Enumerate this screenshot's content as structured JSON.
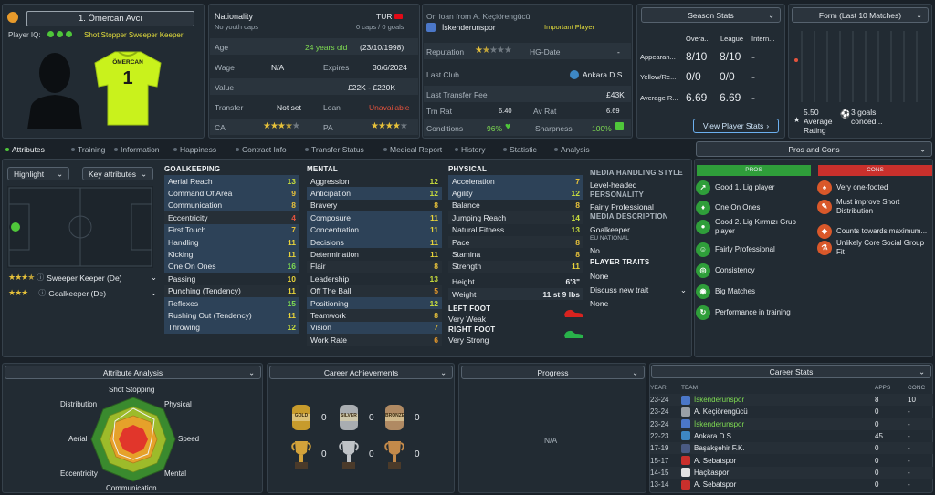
{
  "header": {
    "player_name": "1. Ömercan Avcı",
    "player_iq_label": "Player IQ:",
    "roles": "Shot Stopper  Sweeper Keeper",
    "shirt_name": "ÖMERCAN",
    "shirt_number": "1"
  },
  "info": {
    "nationality_label": "Nationality",
    "nationality_value": "TUR",
    "youth_caps": "No youth caps",
    "caps": "0 caps / 0 goals",
    "age_label": "Age",
    "age_value": "24 years old",
    "dob": "(23/10/1998)",
    "wage_label": "Wage",
    "wage_value": "N/A",
    "expires_label": "Expires",
    "expires_value": "30/6/2024",
    "value_label": "Value",
    "value_value": "£22K - £220K",
    "transfer_label": "Transfer",
    "transfer_value": "Not set",
    "loan_label": "Loan",
    "loan_value": "Unavailable",
    "ca_label": "CA",
    "pa_label": "PA"
  },
  "loan": {
    "on_loan_from": "On loan from A. Keçiörengücü",
    "club": "İskenderunspor",
    "important": "Important Player",
    "reputation_label": "Reputation",
    "hg_label": "HG-Date",
    "hg_value": "-",
    "last_club_label": "Last Club",
    "last_club_value": "Ankara D.S.",
    "last_fee_label": "Last Transfer Fee",
    "last_fee_value": "£43K",
    "trn_label": "Trn Rat",
    "trn_value": "6.40",
    "av_label": "Av Rat",
    "av_value": "6.69",
    "conditions_label": "Conditions",
    "conditions_value": "96%",
    "sharpness_label": "Sharpness",
    "sharpness_value": "100%"
  },
  "season": {
    "title": "Season Stats",
    "col1": "Overa...",
    "col2": "League",
    "col3": "Intern...",
    "rows": [
      {
        "label": "Appearan...",
        "a": "8/10",
        "b": "8/10",
        "c": "-"
      },
      {
        "label": "Yellow/Re...",
        "a": "0/0",
        "b": "0/0",
        "c": "-"
      },
      {
        "label": "Average R...",
        "a": "6.69",
        "b": "6.69",
        "c": "-"
      }
    ],
    "button": "View Player Stats"
  },
  "form": {
    "title": "Form (Last 10 Matches)",
    "avg_value": "5.50",
    "avg_label": "Average Rating",
    "goals_value": "3 goals",
    "goals_label": "conced..."
  },
  "tabs": [
    "Attributes",
    "Training",
    "Information",
    "Happiness",
    "Contract Info",
    "Transfer Status",
    "Medical Report",
    "History",
    "Statistic",
    "Analysis"
  ],
  "pitch": {
    "highlight": "Highlight",
    "key_attributes": "Key attributes",
    "role1": "Sweeper Keeper (De)",
    "role2": "Goalkeeper (De)"
  },
  "goalkeeping": {
    "title": "GOALKEEPING",
    "rows": [
      {
        "name": "Aerial Reach",
        "value": "13"
      },
      {
        "name": "Command Of Area",
        "value": "9"
      },
      {
        "name": "Communication",
        "value": "8"
      },
      {
        "name": "Eccentricity",
        "value": "4"
      },
      {
        "name": "First Touch",
        "value": "7"
      },
      {
        "name": "Handling",
        "value": "11"
      },
      {
        "name": "Kicking",
        "value": "11"
      },
      {
        "name": "One On Ones",
        "value": "16"
      },
      {
        "name": "Passing",
        "value": "10"
      },
      {
        "name": "Punching (Tendency)",
        "value": "11"
      },
      {
        "name": "Reflexes",
        "value": "15"
      },
      {
        "name": "Rushing Out (Tendency)",
        "value": "11"
      },
      {
        "name": "Throwing",
        "value": "12"
      }
    ]
  },
  "mental": {
    "title": "MENTAL",
    "rows": [
      {
        "name": "Aggression",
        "value": "12"
      },
      {
        "name": "Anticipation",
        "value": "12"
      },
      {
        "name": "Bravery",
        "value": "8"
      },
      {
        "name": "Composure",
        "value": "11"
      },
      {
        "name": "Concentration",
        "value": "11"
      },
      {
        "name": "Decisions",
        "value": "11"
      },
      {
        "name": "Determination",
        "value": "11"
      },
      {
        "name": "Flair",
        "value": "8"
      },
      {
        "name": "Leadership",
        "value": "13"
      },
      {
        "name": "Off The Ball",
        "value": "5"
      },
      {
        "name": "Positioning",
        "value": "12"
      },
      {
        "name": "Teamwork",
        "value": "8"
      },
      {
        "name": "Vision",
        "value": "7"
      },
      {
        "name": "Work Rate",
        "value": "6"
      }
    ]
  },
  "physical": {
    "title": "PHYSICAL",
    "rows": [
      {
        "name": "Acceleration",
        "value": "7"
      },
      {
        "name": "Agility",
        "value": "12"
      },
      {
        "name": "Balance",
        "value": "8"
      },
      {
        "name": "Jumping Reach",
        "value": "14"
      },
      {
        "name": "Natural Fitness",
        "value": "13"
      },
      {
        "name": "Pace",
        "value": "8"
      },
      {
        "name": "Stamina",
        "value": "8"
      },
      {
        "name": "Strength",
        "value": "11"
      }
    ],
    "height_label": "Height",
    "height_value": "6'3\"",
    "weight_label": "Weight",
    "weight_value": "11 st 9 lbs",
    "left_foot_label": "LEFT FOOT",
    "left_foot_value": "Very Weak",
    "right_foot_label": "RIGHT FOOT",
    "right_foot_value": "Very Strong"
  },
  "media": {
    "handling_title": "MEDIA HANDLING STYLE",
    "handling_value": "Level-headed",
    "personality_title": "PERSONALITY",
    "personality_value": "Fairly Professional",
    "description_title": "MEDIA DESCRIPTION",
    "description_value": "Goalkeeper",
    "eu_title": "EU NATIONAL",
    "eu_value": "No",
    "traits_title": "PLAYER TRAITS",
    "traits_value": "None",
    "discuss": "Discuss new trait",
    "none2": "None"
  },
  "proscons": {
    "title": "Pros and Cons",
    "pros_label": "PROS",
    "cons_label": "CONS",
    "pros": [
      "Good 1. Lig player",
      "One On Ones",
      "Good 2. Lig Kırmızı Grup player",
      "Fairly Professional",
      "Consistency",
      "Big Matches",
      "Performance in training"
    ],
    "cons": [
      "Very one-footed",
      "Must improve Short Distribution",
      "Counts towards maximum...",
      "Unlikely Core Social Group Fit"
    ]
  },
  "analysis": {
    "title": "Attribute Analysis",
    "labels": [
      "Shot Stopping",
      "Physical",
      "Speed",
      "Mental",
      "Communication",
      "Eccentricity",
      "Aerial",
      "Distribution"
    ]
  },
  "achievements": {
    "title": "Career Achievements",
    "medal_counts": [
      "0",
      "0",
      "0"
    ],
    "trophy_counts": [
      "0",
      "0",
      "0"
    ],
    "medal_labels": [
      "GOLD",
      "SILVER",
      "BRONZE"
    ]
  },
  "progress": {
    "title": "Progress",
    "value": "N/A"
  },
  "career": {
    "title": "Career Stats",
    "h_year": "YEAR",
    "h_team": "TEAM",
    "h_apps": "APPS",
    "h_conc": "CONC",
    "rows": [
      {
        "year": "23-24",
        "team": "İskenderunspor",
        "apps": "8",
        "conc": "10",
        "hl": true
      },
      {
        "year": "23-24",
        "team": "A. Keçiörengücü",
        "apps": "0",
        "conc": "-",
        "hl": false
      },
      {
        "year": "23-24",
        "team": "İskenderunspor",
        "apps": "0",
        "conc": "-",
        "hl": true
      },
      {
        "year": "22-23",
        "team": "Ankara D.S.",
        "apps": "45",
        "conc": "-",
        "hl": false
      },
      {
        "year": "17-19",
        "team": "Başakşehir F.K.",
        "apps": "0",
        "conc": "-",
        "hl": false
      },
      {
        "year": "15-17",
        "team": "A. Sebatspor",
        "apps": "0",
        "conc": "-",
        "hl": false
      },
      {
        "year": "14-15",
        "team": "Haçkaspor",
        "apps": "0",
        "conc": "-",
        "hl": false
      },
      {
        "year": "13-14",
        "team": "A. Sebatspor",
        "apps": "0",
        "conc": "-",
        "hl": false
      }
    ]
  },
  "colors": {
    "accent_green": "#4fc63a",
    "pros_green": "#2f9e3a",
    "cons_red": "#c9302c",
    "highlight_blue": "#2d4258"
  }
}
